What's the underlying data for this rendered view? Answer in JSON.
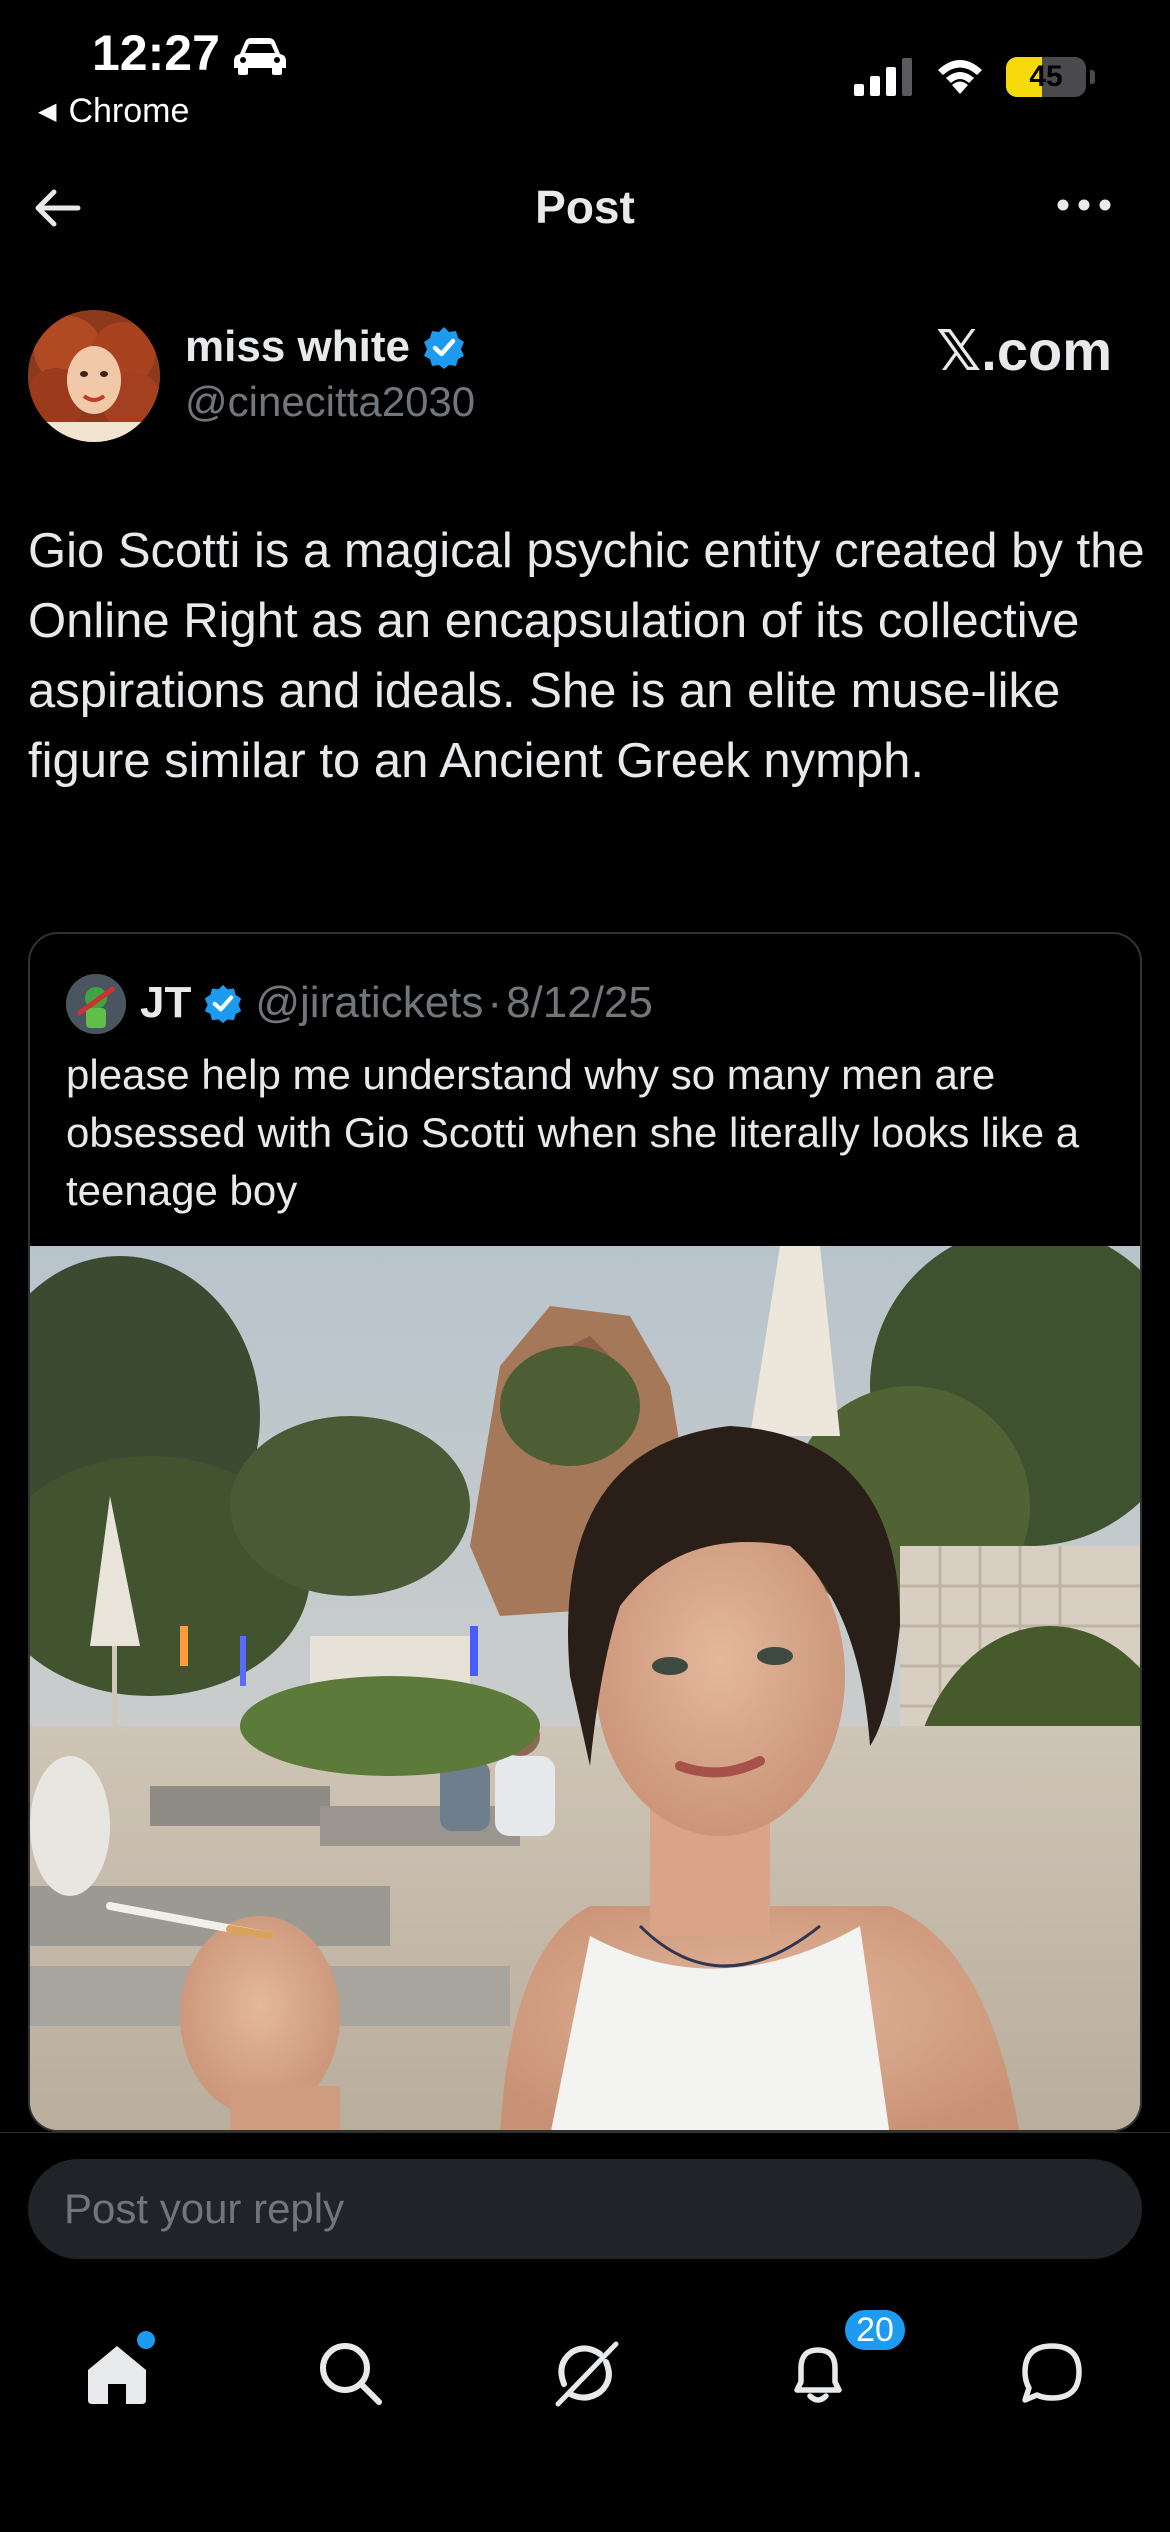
{
  "status_bar": {
    "time": "12:27",
    "back_app": "Chrome",
    "battery_level": "45",
    "battery_fraction": 0.45,
    "icons": [
      "car-icon",
      "signal-icon",
      "wifi-icon",
      "battery-icon"
    ]
  },
  "header": {
    "title": "Post",
    "back_icon": "arrow-left-icon",
    "more_icon": "more-horizontal-icon"
  },
  "post": {
    "author_name": "miss white",
    "author_handle": "@cinecitta2030",
    "verified": true,
    "source_label": "𝕏.com",
    "text": "Gio Scotti is a magical psychic entity created by the Online Right as an encapsulation of its collective aspirations and ideals. She is an elite muse-like figure similar to an Ancient Greek nymph."
  },
  "quoted_post": {
    "author_name": "JT",
    "author_handle": "@jiratickets",
    "separator": "·",
    "date": "8/12/25",
    "verified": true,
    "text": "please help me understand why so many men are obsessed with Gio Scotti when she literally looks like a teenage boy"
  },
  "reply": {
    "placeholder": "Post your reply"
  },
  "tab_bar": {
    "items": [
      "home-icon",
      "search-icon",
      "grok-icon",
      "notifications-icon",
      "messages-icon"
    ],
    "notification_count": "20"
  },
  "colors": {
    "background": "#000000",
    "accent": "#1d9bf0",
    "secondary_text": "#71767b",
    "battery": "#f5d90a"
  }
}
